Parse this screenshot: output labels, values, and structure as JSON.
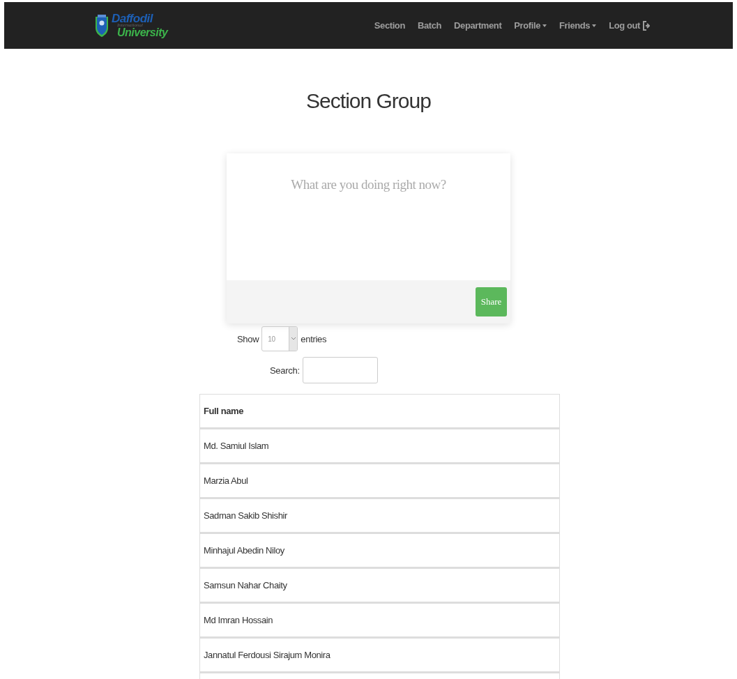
{
  "navbar": {
    "brand": {
      "line1": "Daffodil",
      "line2": "International",
      "line3": "University"
    },
    "links": [
      {
        "label": "Section",
        "kind": "link"
      },
      {
        "label": "Batch",
        "kind": "link"
      },
      {
        "label": "Department",
        "kind": "link"
      },
      {
        "label": "Profile",
        "kind": "dropdown"
      },
      {
        "label": "Friends",
        "kind": "dropdown"
      },
      {
        "label": "Log out",
        "kind": "logout"
      }
    ]
  },
  "title": "Section Group",
  "post_box": {
    "placeholder": "What are you doing right now?",
    "button": "Share"
  },
  "length_control": {
    "before": "Show",
    "value": "10",
    "after": "entries"
  },
  "search": {
    "label": "Search:"
  },
  "table": {
    "columns": [
      "Full name"
    ],
    "rows": [
      [
        "Md. Samiul Islam"
      ],
      [
        "Marzia Abul"
      ],
      [
        "Sadman Sakib Shishir"
      ],
      [
        "Minhajul Abedin Niloy"
      ],
      [
        "Samsun Nahar Chaity"
      ],
      [
        "Md Imran Hossain"
      ],
      [
        "Jannatul Ferdousi Sirajum Monira"
      ]
    ]
  }
}
